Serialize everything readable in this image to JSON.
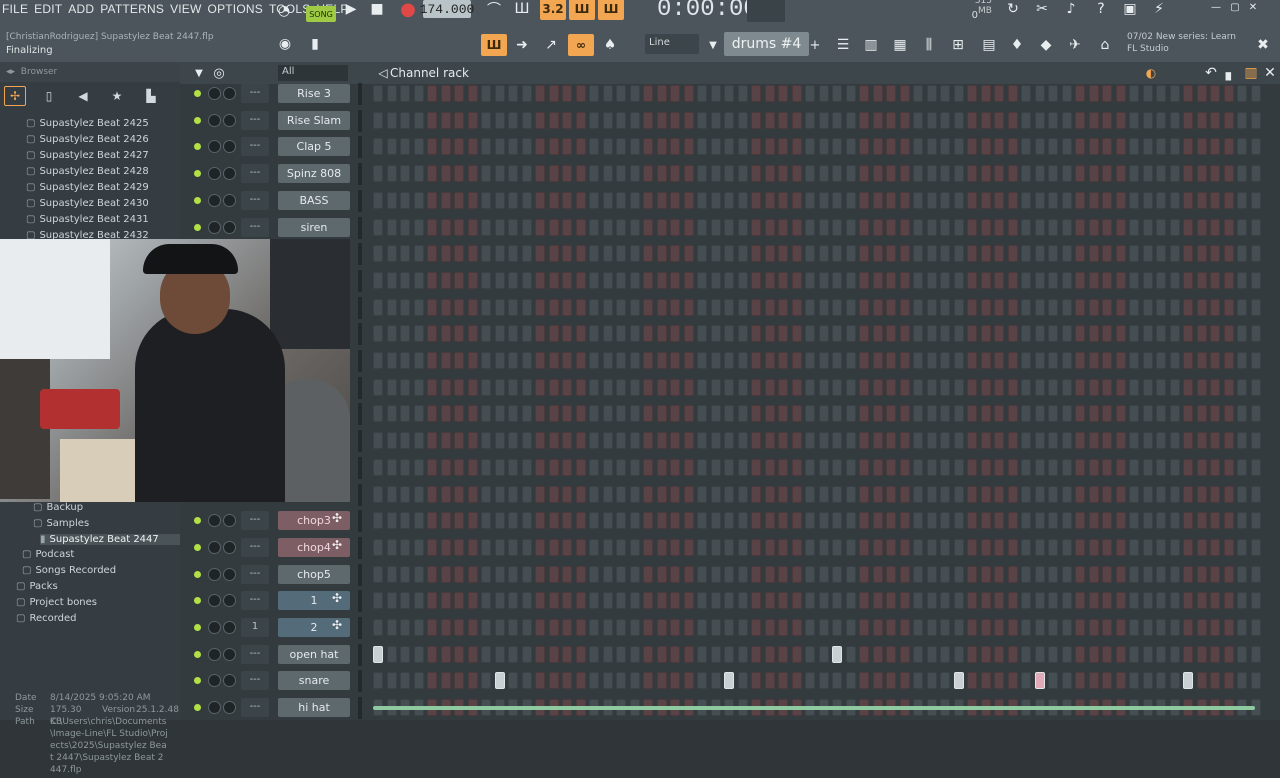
{
  "menu": [
    "FILE",
    "EDIT",
    "ADD",
    "PATTERNS",
    "VIEW",
    "OPTIONS",
    "TOOLS",
    "HELP"
  ],
  "transport": {
    "song_mode": "SONG",
    "tempo": "174.000",
    "timecode": "0:00:00"
  },
  "performance": {
    "memory": "515 MB",
    "cpu": "0"
  },
  "project": {
    "hint_path": "[ChristianRodriguez] Supastylez Beat 2447.flp",
    "status": "Finalizing"
  },
  "snap": {
    "value": "Line"
  },
  "pattern": {
    "name": "drums #4"
  },
  "news": {
    "date": "07/02",
    "line1": "New series: Learn",
    "line2": "FL Studio"
  },
  "browser": {
    "title": "Browser",
    "filter": "All",
    "tree": [
      {
        "label": "Supastylez Beat 2425",
        "kind": "folder"
      },
      {
        "label": "Supastylez Beat 2426",
        "kind": "folder"
      },
      {
        "label": "Supastylez Beat 2427",
        "kind": "folder"
      },
      {
        "label": "Supastylez Beat 2428",
        "kind": "folder"
      },
      {
        "label": "Supastylez Beat 2429",
        "kind": "folder"
      },
      {
        "label": "Supastylez Beat 2430",
        "kind": "folder"
      },
      {
        "label": "Supastylez Beat 2431",
        "kind": "folder"
      },
      {
        "label": "Supastylez Beat 2432",
        "kind": "folder"
      }
    ],
    "tree_lower": [
      {
        "label": "Backup",
        "kind": "folder"
      },
      {
        "label": "Samples",
        "kind": "folder"
      },
      {
        "label": "Supastylez Beat 2447",
        "kind": "file"
      },
      {
        "label": "Podcast",
        "kind": "folder"
      },
      {
        "label": "Songs Recorded",
        "kind": "folder"
      },
      {
        "label": "Packs",
        "kind": "folder"
      },
      {
        "label": "Project bones",
        "kind": "folder"
      },
      {
        "label": "Recorded",
        "kind": "folder"
      }
    ],
    "file_info": {
      "date_label": "Date",
      "date": "8/14/2025 9:05:20 AM",
      "size_label": "Size",
      "size": "175.30 KB",
      "version_label": "Version",
      "version": "25.1.2.48",
      "path_label": "Path",
      "path": "C:\\Users\\chris\\Documents\\Image-Line\\FL Studio\\Projects\\2025\\Supastylez Beat 2447\\Supastylez Beat 2447.flp"
    }
  },
  "channel_rack": {
    "title": "Channel rack",
    "channels": [
      {
        "name": "Rise 3",
        "route": "---",
        "style": "grey",
        "plus": false,
        "hits": [],
        "hidden": false
      },
      {
        "name": "Rise Slam",
        "route": "---",
        "style": "grey",
        "plus": false,
        "hits": [],
        "hidden": false
      },
      {
        "name": "Clap 5",
        "route": "---",
        "style": "grey",
        "plus": false,
        "hits": [],
        "hidden": false
      },
      {
        "name": "Spinz 808",
        "route": "---",
        "style": "grey",
        "plus": false,
        "hits": [],
        "hidden": false
      },
      {
        "name": "BASS",
        "route": "---",
        "style": "grey",
        "plus": false,
        "hits": [],
        "hidden": false
      },
      {
        "name": "siren",
        "route": "---",
        "style": "grey",
        "plus": false,
        "hits": [],
        "hidden": false
      },
      {
        "name": "",
        "route": "",
        "style": "grey",
        "plus": false,
        "hits": [],
        "hidden": true
      },
      {
        "name": "",
        "route": "",
        "style": "grey",
        "plus": false,
        "hits": [],
        "hidden": true
      },
      {
        "name": "",
        "route": "",
        "style": "grey",
        "plus": false,
        "hits": [],
        "hidden": true
      },
      {
        "name": "",
        "route": "",
        "style": "grey",
        "plus": false,
        "hits": [],
        "hidden": true
      },
      {
        "name": "",
        "route": "",
        "style": "grey",
        "plus": false,
        "hits": [],
        "hidden": true
      },
      {
        "name": "",
        "route": "",
        "style": "grey",
        "plus": false,
        "hits": [],
        "hidden": true
      },
      {
        "name": "",
        "route": "",
        "style": "grey",
        "plus": false,
        "hits": [],
        "hidden": true
      },
      {
        "name": "",
        "route": "",
        "style": "grey",
        "plus": false,
        "hits": [],
        "hidden": true
      },
      {
        "name": "",
        "route": "",
        "style": "grey",
        "plus": false,
        "hits": [],
        "hidden": true
      },
      {
        "name": "",
        "route": "",
        "style": "grey",
        "plus": false,
        "hits": [],
        "hidden": true
      },
      {
        "name": "chop3",
        "route": "---",
        "style": "pink",
        "plus": true,
        "hits": [],
        "hidden": false
      },
      {
        "name": "chop4",
        "route": "---",
        "style": "pink",
        "plus": true,
        "hits": [],
        "hidden": false
      },
      {
        "name": "chop5",
        "route": "---",
        "style": "grey",
        "plus": false,
        "hits": [],
        "hidden": false
      },
      {
        "name": "1",
        "route": "---",
        "style": "blue",
        "plus": true,
        "hits": [],
        "hidden": false
      },
      {
        "name": "2",
        "route": "1",
        "style": "blue",
        "plus": true,
        "hits": [],
        "hidden": false
      },
      {
        "name": "open hat",
        "route": "---",
        "style": "grey",
        "plus": false,
        "hits": [
          0,
          34
        ],
        "hidden": false
      },
      {
        "name": "snare",
        "route": "---",
        "style": "grey",
        "plus": false,
        "hits": [
          9,
          26,
          43,
          49,
          60
        ],
        "pink_hits": [
          49
        ],
        "hidden": false
      },
      {
        "name": "hi hat",
        "route": "---",
        "style": "grey",
        "plus": false,
        "hits": [],
        "hidden": false
      }
    ],
    "step_count": 66
  },
  "colors": {
    "accent": "#f2a651",
    "led": "#b3e046",
    "song": "#9ecb43"
  }
}
